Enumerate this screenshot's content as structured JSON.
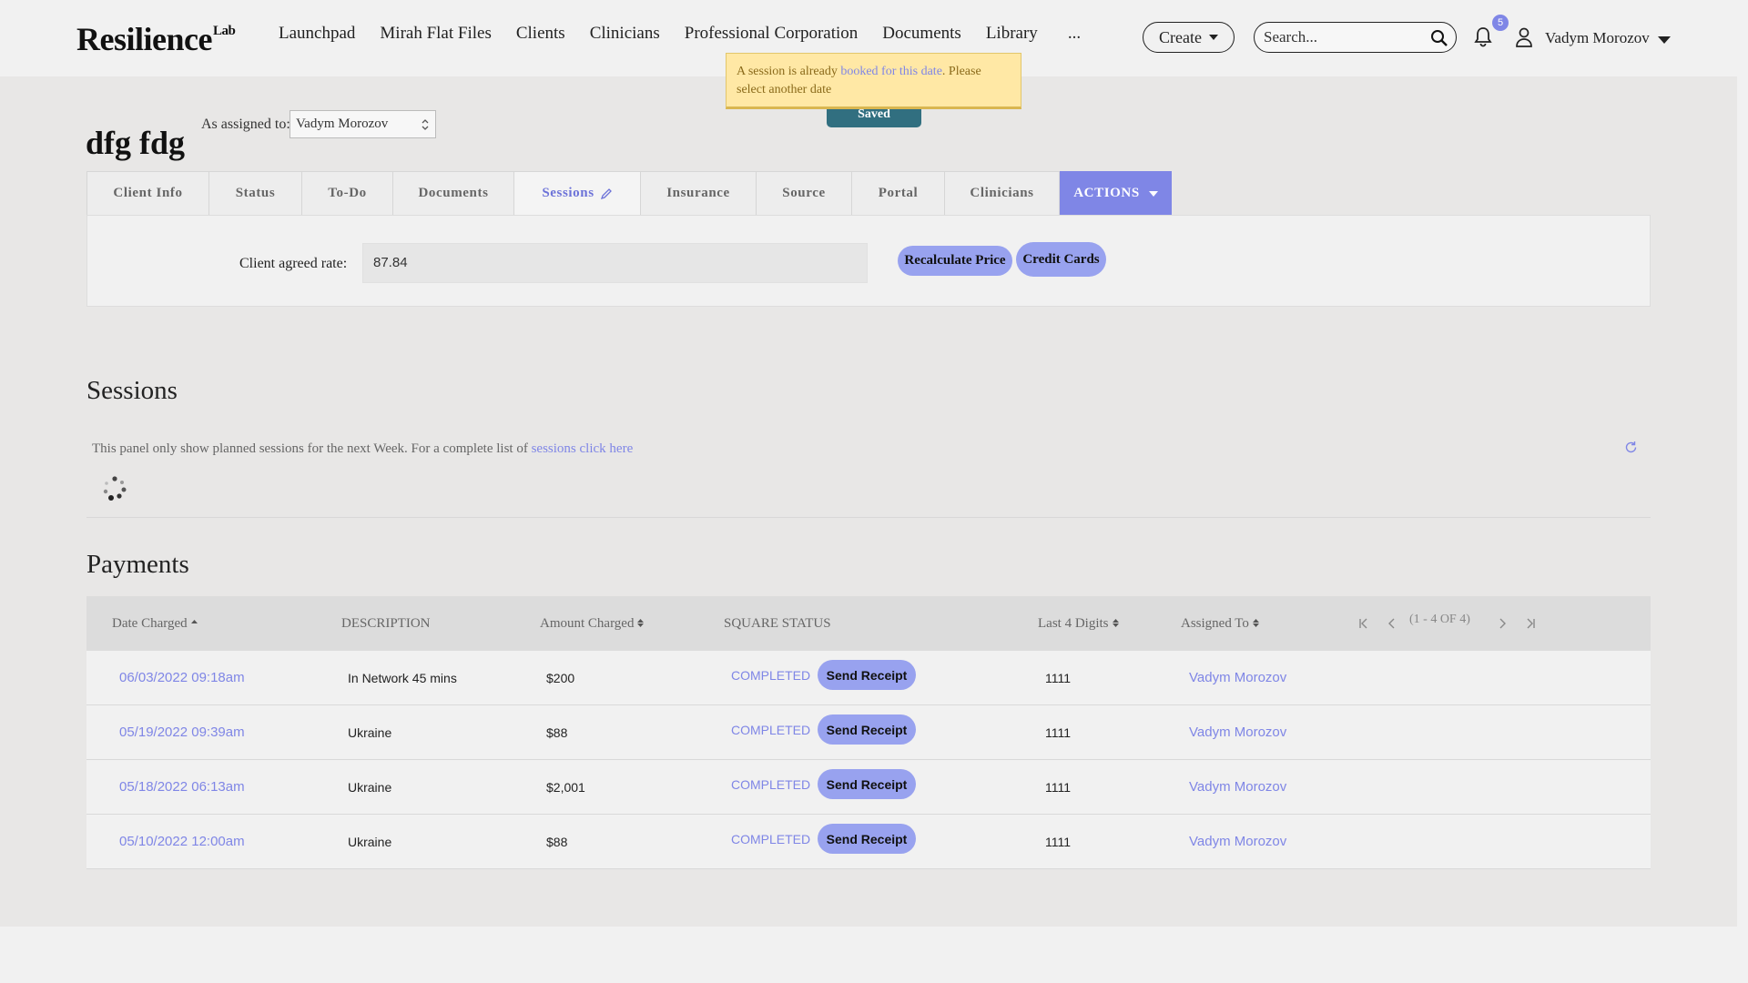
{
  "header": {
    "logo_text": "Resilience",
    "logo_sup": "Lab",
    "nav": [
      "Launchpad",
      "Mirah Flat Files",
      "Clients",
      "Clinicians",
      "Professional Corporation",
      "Documents",
      "Library",
      "..."
    ],
    "create_label": "Create",
    "search_placeholder": "Search...",
    "notification_count": "5",
    "user_name": "Vadym Morozov"
  },
  "toast": {
    "text_before": "A session is already ",
    "link_text": "booked for this date",
    "text_after": ". Please select another date"
  },
  "saved_label": "Saved",
  "client": {
    "name": "dfg fdg",
    "assigned_label": "As assigned to:",
    "assigned_value": "Vadym Morozov"
  },
  "tabs": [
    "Client Info",
    "Status",
    "To-Do",
    "Documents",
    "Sessions",
    "Insurance",
    "Source",
    "Portal",
    "Clinicians",
    "ACTIONS"
  ],
  "active_tab": "Sessions",
  "rate": {
    "label": "Client agreed rate:",
    "value": "87.84",
    "recalculate_label": "Recalculate Price",
    "credit_cards_label": "Credit Cards"
  },
  "sessions": {
    "title": "Sessions",
    "note_before": "This panel only show planned sessions for the next Week. For a complete list of ",
    "note_link": "sessions click here"
  },
  "payments": {
    "title": "Payments",
    "columns": [
      "Date Charged",
      "DESCRIPTION",
      "Amount Charged",
      "SQUARE STATUS",
      "Last 4 Digits",
      "Assigned To"
    ],
    "pager_text": "(1 - 4 OF 4)",
    "send_receipt_label": "Send Receipt",
    "rows": [
      {
        "date": "06/03/2022 09:18am",
        "description": "In Network 45 mins",
        "amount": "$200",
        "status": "COMPLETED",
        "last4": "1111",
        "assigned": "Vadym Morozov"
      },
      {
        "date": "05/19/2022 09:39am",
        "description": "Ukraine",
        "amount": "$88",
        "status": "COMPLETED",
        "last4": "1111",
        "assigned": "Vadym Morozov"
      },
      {
        "date": "05/18/2022 06:13am",
        "description": "Ukraine",
        "amount": "$2,001",
        "status": "COMPLETED",
        "last4": "1111",
        "assigned": "Vadym Morozov"
      },
      {
        "date": "05/10/2022 12:00am",
        "description": "Ukraine",
        "amount": "$88",
        "status": "COMPLETED",
        "last4": "1111",
        "assigned": "Vadym Morozov"
      }
    ]
  },
  "colors": {
    "accent": "#7f86e6",
    "pill": "#98a2ef",
    "saved": "#316f80",
    "toast_bg": "#ffe8a5"
  }
}
